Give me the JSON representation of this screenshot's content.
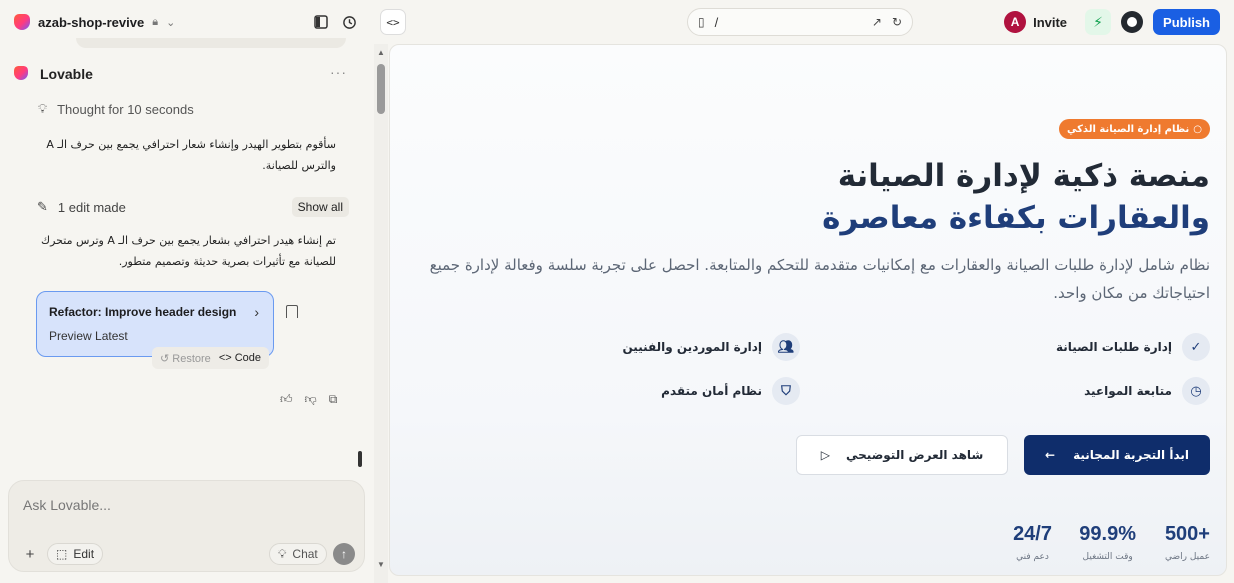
{
  "app": {
    "project_name": "azab-shop-revive",
    "url_path": "/",
    "invite_label": "Invite",
    "avatar_initial": "A",
    "publish_label": "Publish"
  },
  "chat": {
    "author": "Lovable",
    "more": "···",
    "thought": "Thought for 10 seconds",
    "message1": "سأقوم بتطوير الهيدر وإنشاء شعار احترافي يجمع بين حرف الـ A والترس للصيانة.",
    "edits_label": "1 edit made",
    "show_all": "Show all",
    "message2": "تم إنشاء هيدر احترافي بشعار يجمع بين حرف الـ A وترس متحرك للصيانة مع تأثيرات بصرية حديثة وتصميم متطور.",
    "card_title": "Refactor: Improve header design",
    "card_sub": "Preview Latest",
    "restore": "Restore",
    "code": "Code",
    "composer_placeholder": "Ask Lovable...",
    "edit_label": "Edit",
    "chat_label": "Chat"
  },
  "preview": {
    "badge": "نظام إدارة الصيانة الذكي",
    "h1_line1": "منصة ذكية لإدارة الصيانة",
    "h1_line2": "والعقارات بكفاءة معاصرة",
    "lede": "نظام شامل لإدارة طلبات الصيانة والعقارات مع إمكانيات متقدمة للتحكم والمتابعة. احصل على تجربة سلسة وفعالة لإدارة جميع احتياجاتك من مكان واحد.",
    "features": [
      {
        "label": "إدارة طلبات الصيانة",
        "icon": "check-circle-icon"
      },
      {
        "label": "إدارة الموردين والفنيين",
        "icon": "users-icon"
      },
      {
        "label": "متابعة المواعيد",
        "icon": "clock-icon"
      },
      {
        "label": "نظام أمان متقدم",
        "icon": "shield-icon"
      }
    ],
    "cta_primary": "ابدأ التجربة المجانية",
    "cta_secondary": "شاهد العرض التوضيحي",
    "stats": [
      {
        "value": "500+",
        "label": "عميل راضي"
      },
      {
        "value": "99.9%",
        "label": "وقت التشغيل"
      },
      {
        "value": "24/7",
        "label": "دعم فني"
      }
    ]
  },
  "colors": {
    "publish": "#1a5fe3",
    "primary": "#0f2d6b",
    "accent": "#ef7a2f",
    "heading_blue": "#1f3e7a"
  }
}
